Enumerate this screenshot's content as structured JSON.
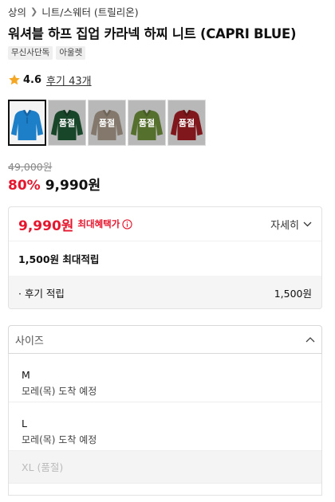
{
  "breadcrumb": {
    "items": [
      "상의",
      "니트/스웨터 (트릴리온)"
    ]
  },
  "product": {
    "title": "워셔블 하프 집업 카라넥 하찌 니트 (CAPRI BLUE)",
    "tags": [
      "무신사단독",
      "아울렛"
    ],
    "rating": "4.6",
    "reviews_label": "후기 43개",
    "original_price": "49,000원",
    "discount": "80%",
    "sale_price": "9,990원"
  },
  "thumbnails": [
    {
      "color": "#1d7fc8",
      "sold_out_label": ""
    },
    {
      "color": "#1f5a35",
      "sold_out_label": "품절"
    },
    {
      "color": "#a89a8a",
      "sold_out_label": "품절"
    },
    {
      "color": "#6e8f3a",
      "sold_out_label": "품절"
    },
    {
      "color": "#a31e24",
      "sold_out_label": "품절"
    }
  ],
  "benefit": {
    "best_price": "9,990원",
    "best_label": "최대혜택가",
    "detail_label": "자세히",
    "points_label": "1,500원 최대적립",
    "review_points_label": "· 후기 적립",
    "review_points_amount": "1,500원"
  },
  "size": {
    "placeholder": "사이즈",
    "options": [
      {
        "name": "M",
        "note": "모레(목) 도착 예정"
      },
      {
        "name": "L",
        "note": "모레(목) 도착 예정"
      },
      {
        "name": "XL (품절)",
        "note": ""
      }
    ]
  },
  "colors": {
    "accent_red": "#e5162d",
    "star": "#f5a623"
  }
}
